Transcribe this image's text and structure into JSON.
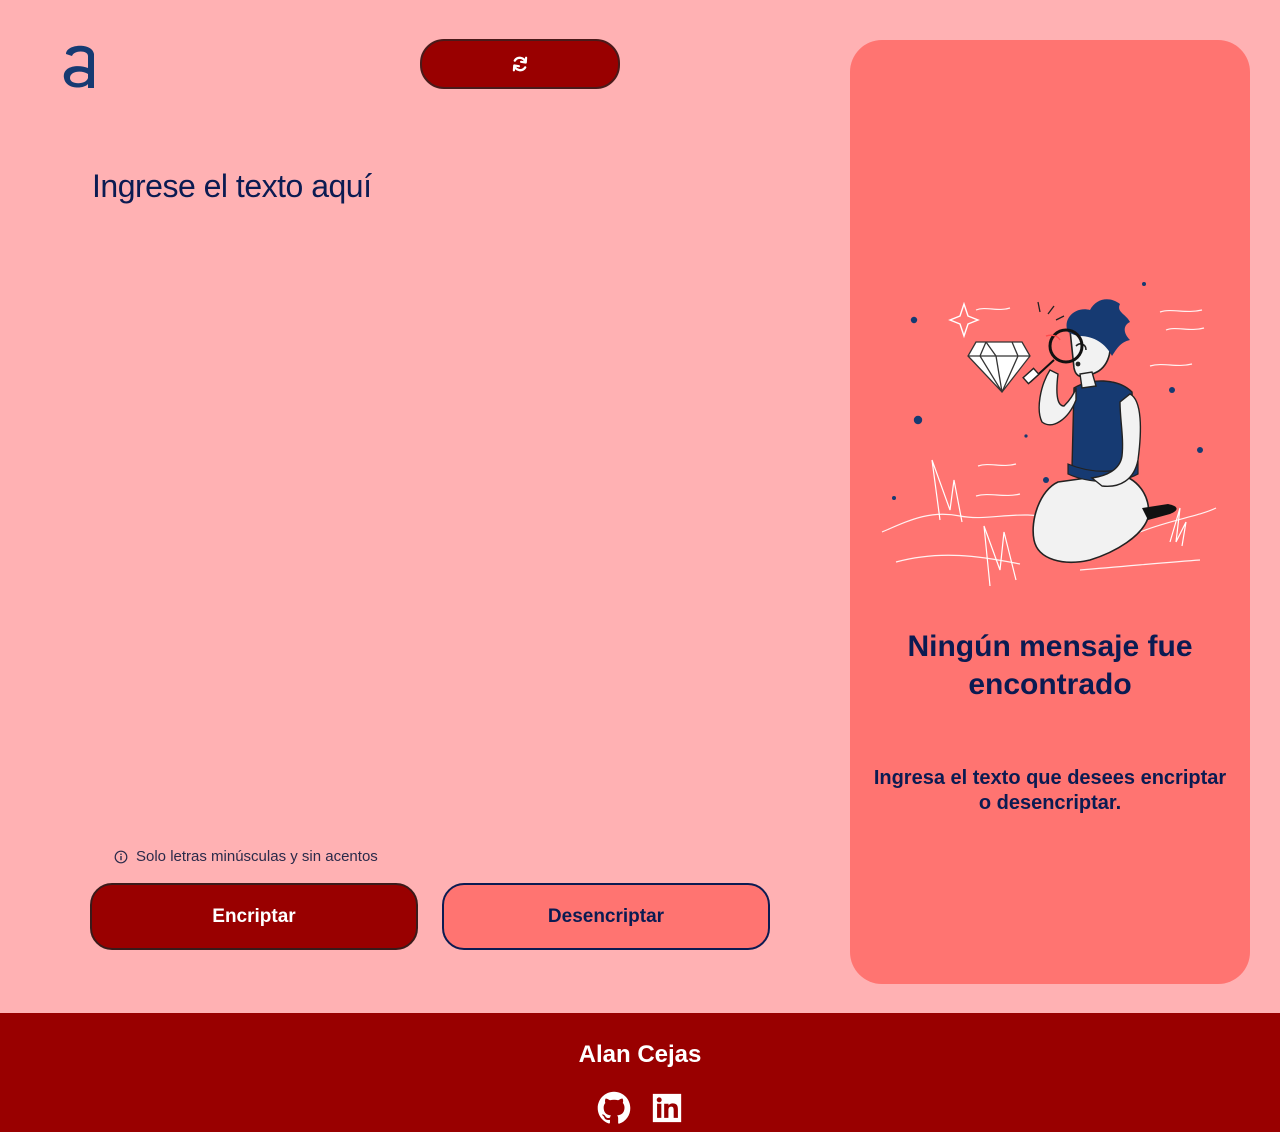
{
  "header": {
    "logo_icon": "letter-a-logo",
    "theme_toggle_icon": "refresh-icon"
  },
  "editor": {
    "placeholder": "Ingrese el texto aquí",
    "value": ""
  },
  "hint": {
    "icon": "info-icon",
    "text": "Solo letras minúsculas y sin acentos"
  },
  "actions": {
    "encrypt_label": "Encriptar",
    "decrypt_label": "Desencriptar"
  },
  "result_panel": {
    "illustration_icon": "person-magnifying-glass-illustration",
    "title": "Ningún mensaje fue encontrado",
    "message": "Ingresa el texto que desees encriptar o desencriptar."
  },
  "footer": {
    "author": "Alan Cejas",
    "links": [
      {
        "icon": "github-icon"
      },
      {
        "icon": "linkedin-icon"
      }
    ]
  },
  "colors": {
    "background": "#ffb1b3",
    "primary": "#990000",
    "panel": "#ff7471",
    "text_dark": "#0b1b52"
  }
}
